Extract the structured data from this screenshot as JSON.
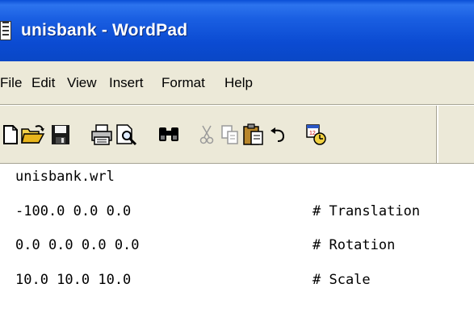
{
  "window": {
    "title": "unisbank - WordPad",
    "icon": "wordpad-document-icon"
  },
  "menubar": {
    "items": [
      "File",
      "Edit",
      "View",
      "Insert",
      "Format",
      "Help"
    ]
  },
  "toolbar": {
    "buttons": [
      {
        "name": "new-icon",
        "enabled": true
      },
      {
        "name": "open-icon",
        "enabled": true
      },
      {
        "name": "save-icon",
        "enabled": true
      },
      {
        "name": "print-icon",
        "enabled": true
      },
      {
        "name": "print-preview-icon",
        "enabled": true
      },
      {
        "name": "find-icon",
        "enabled": true
      },
      {
        "name": "cut-icon",
        "enabled": false
      },
      {
        "name": "copy-icon",
        "enabled": false
      },
      {
        "name": "paste-icon",
        "enabled": true
      },
      {
        "name": "undo-icon",
        "enabled": true
      },
      {
        "name": "date-time-icon",
        "enabled": true
      }
    ]
  },
  "document": {
    "lines": [
      {
        "text": "unisbank.wrl",
        "comment": ""
      },
      {
        "text": "-100.0 0.0 0.0",
        "comment": "# Translation"
      },
      {
        "text": "0.0 0.0 0.0 0.0",
        "comment": "# Rotation"
      },
      {
        "text": "10.0 10.0 10.0",
        "comment": "# Scale"
      }
    ]
  },
  "colors": {
    "titlebar": "#0b4bd2",
    "chrome": "#ece9d8"
  }
}
